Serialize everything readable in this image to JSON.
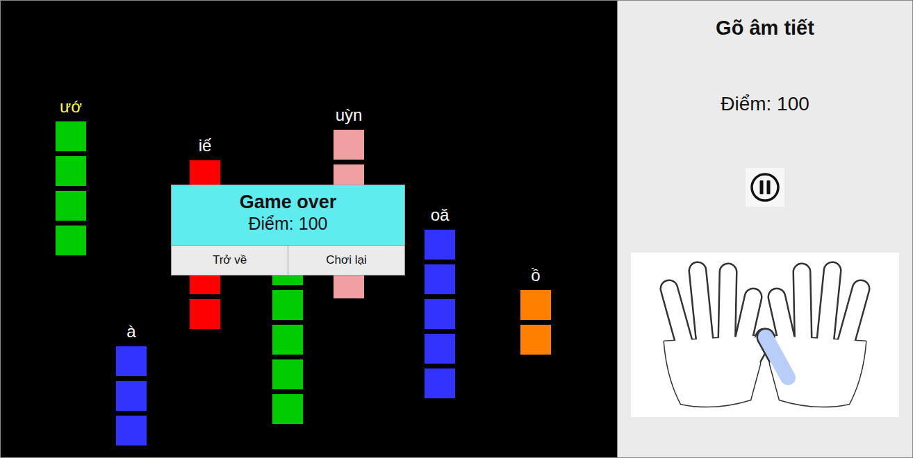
{
  "panel": {
    "title": "Gõ âm tiết",
    "score": "Điểm: 100"
  },
  "game": {
    "columns": [
      {
        "label": "ướ",
        "selected": true,
        "blocks": 4,
        "color": "#00cc00"
      },
      {
        "label": "à",
        "selected": false,
        "blocks": 3,
        "color": "#3333ff"
      },
      {
        "label": "iế",
        "selected": false,
        "blocks": 5,
        "color": "#ff0000"
      },
      {
        "selected": false,
        "blocks": 6,
        "color": "#00cc00"
      },
      {
        "label": "uỳn",
        "selected": false,
        "blocks": 5,
        "color": "#f0a0a0"
      },
      {
        "label": "oă",
        "selected": false,
        "blocks": 5,
        "color": "#3333ff"
      },
      {
        "label": "ồ",
        "selected": false,
        "blocks": 2,
        "color": "#ff8000"
      }
    ]
  },
  "dialog": {
    "title": "Game over",
    "score": "Điểm: 100",
    "buttons": [
      "Trở về",
      "Chơi lại"
    ]
  },
  "hands": {
    "highlighted_finger": "right-thumb"
  }
}
